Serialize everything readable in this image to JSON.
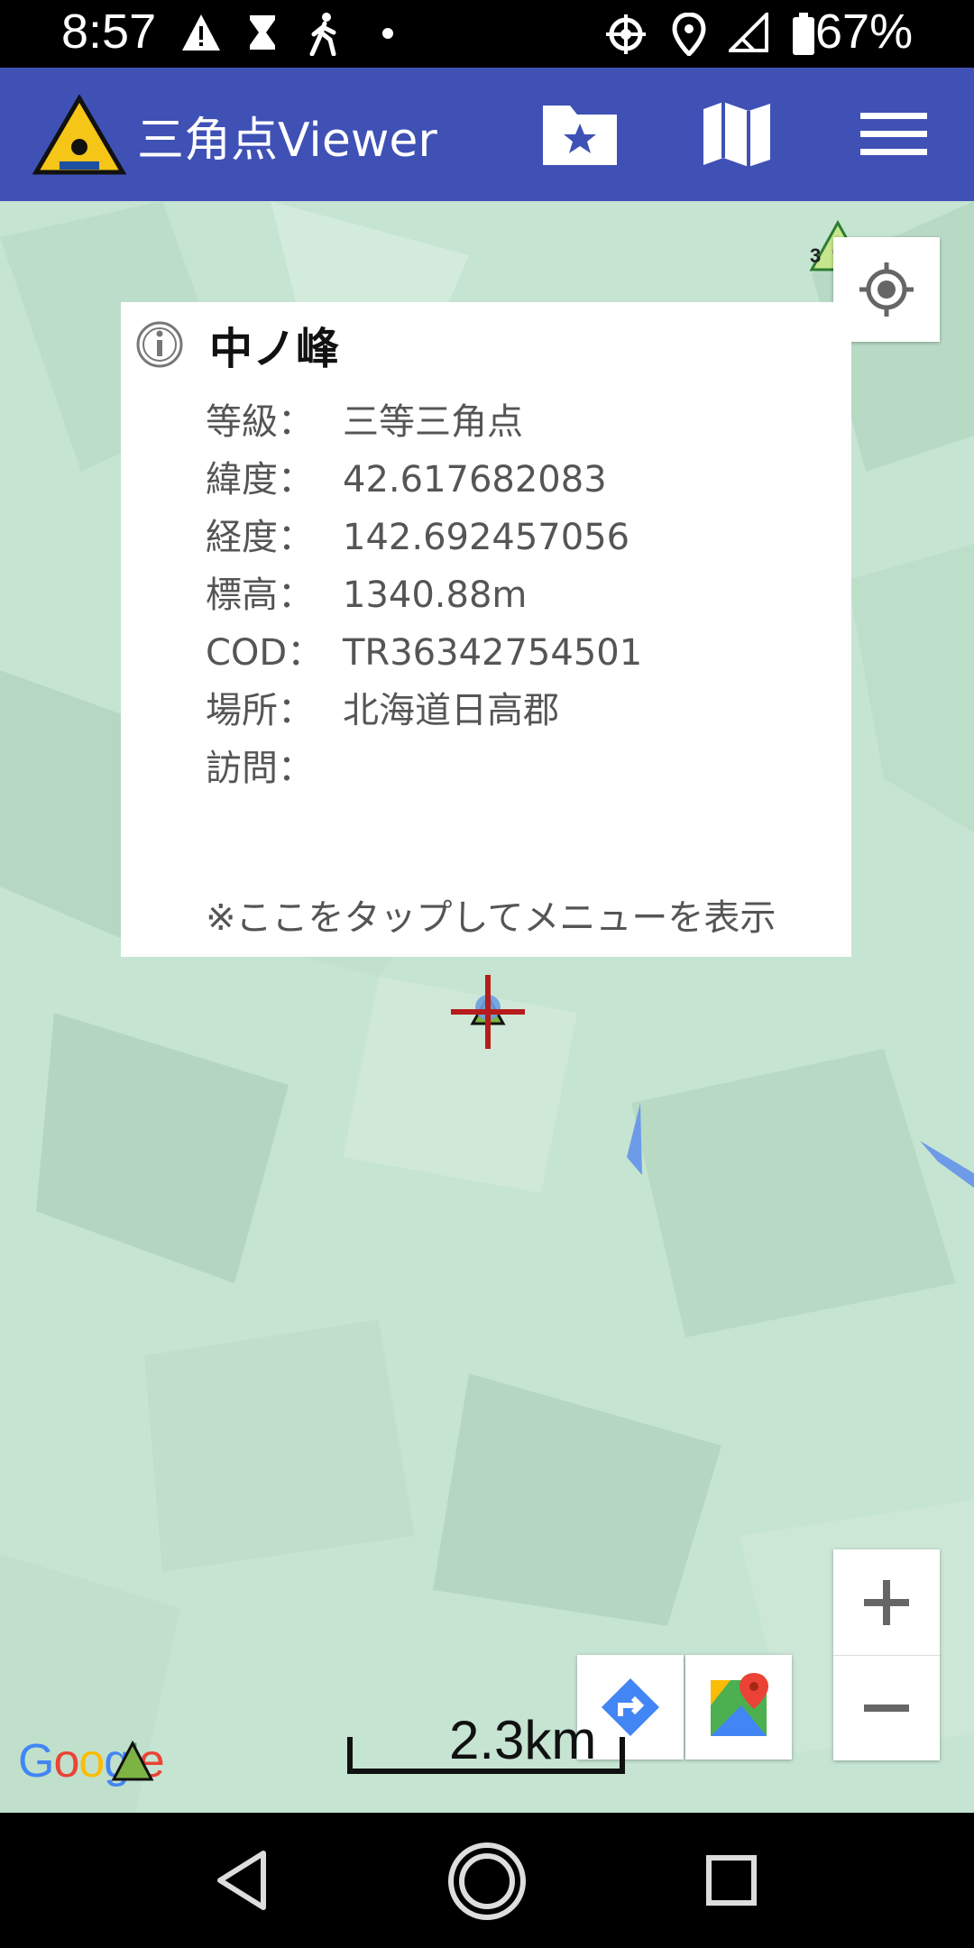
{
  "status_bar": {
    "time": "8:57",
    "battery": "67%",
    "icons": [
      "warning-icon",
      "hourglass-icon",
      "walking-icon",
      "dot-icon",
      "gps-icon",
      "location-icon",
      "signal-icon",
      "battery-icon"
    ]
  },
  "app_bar": {
    "title": "三角点Viewer",
    "color": "#3f51b5",
    "actions": [
      "folder-star-icon",
      "map-icon",
      "menu-icon"
    ]
  },
  "info_card": {
    "name": "中ノ峰",
    "rows": [
      {
        "label": "等級：",
        "value": "三等三角点"
      },
      {
        "label": "緯度：",
        "value": "42.617682083"
      },
      {
        "label": "経度：",
        "value": "142.692457056"
      },
      {
        "label": "標高：",
        "value": "1340.88m"
      },
      {
        "label": "COD：",
        "value": "TR36342754501"
      },
      {
        "label": "場所：",
        "value": "北海道日高郡"
      },
      {
        "label": "訪問：",
        "value": ""
      }
    ],
    "hint": "※ここをタップしてメニューを表示"
  },
  "map": {
    "marker_label": "3",
    "scale": "2.3km",
    "attribution": "Google"
  }
}
